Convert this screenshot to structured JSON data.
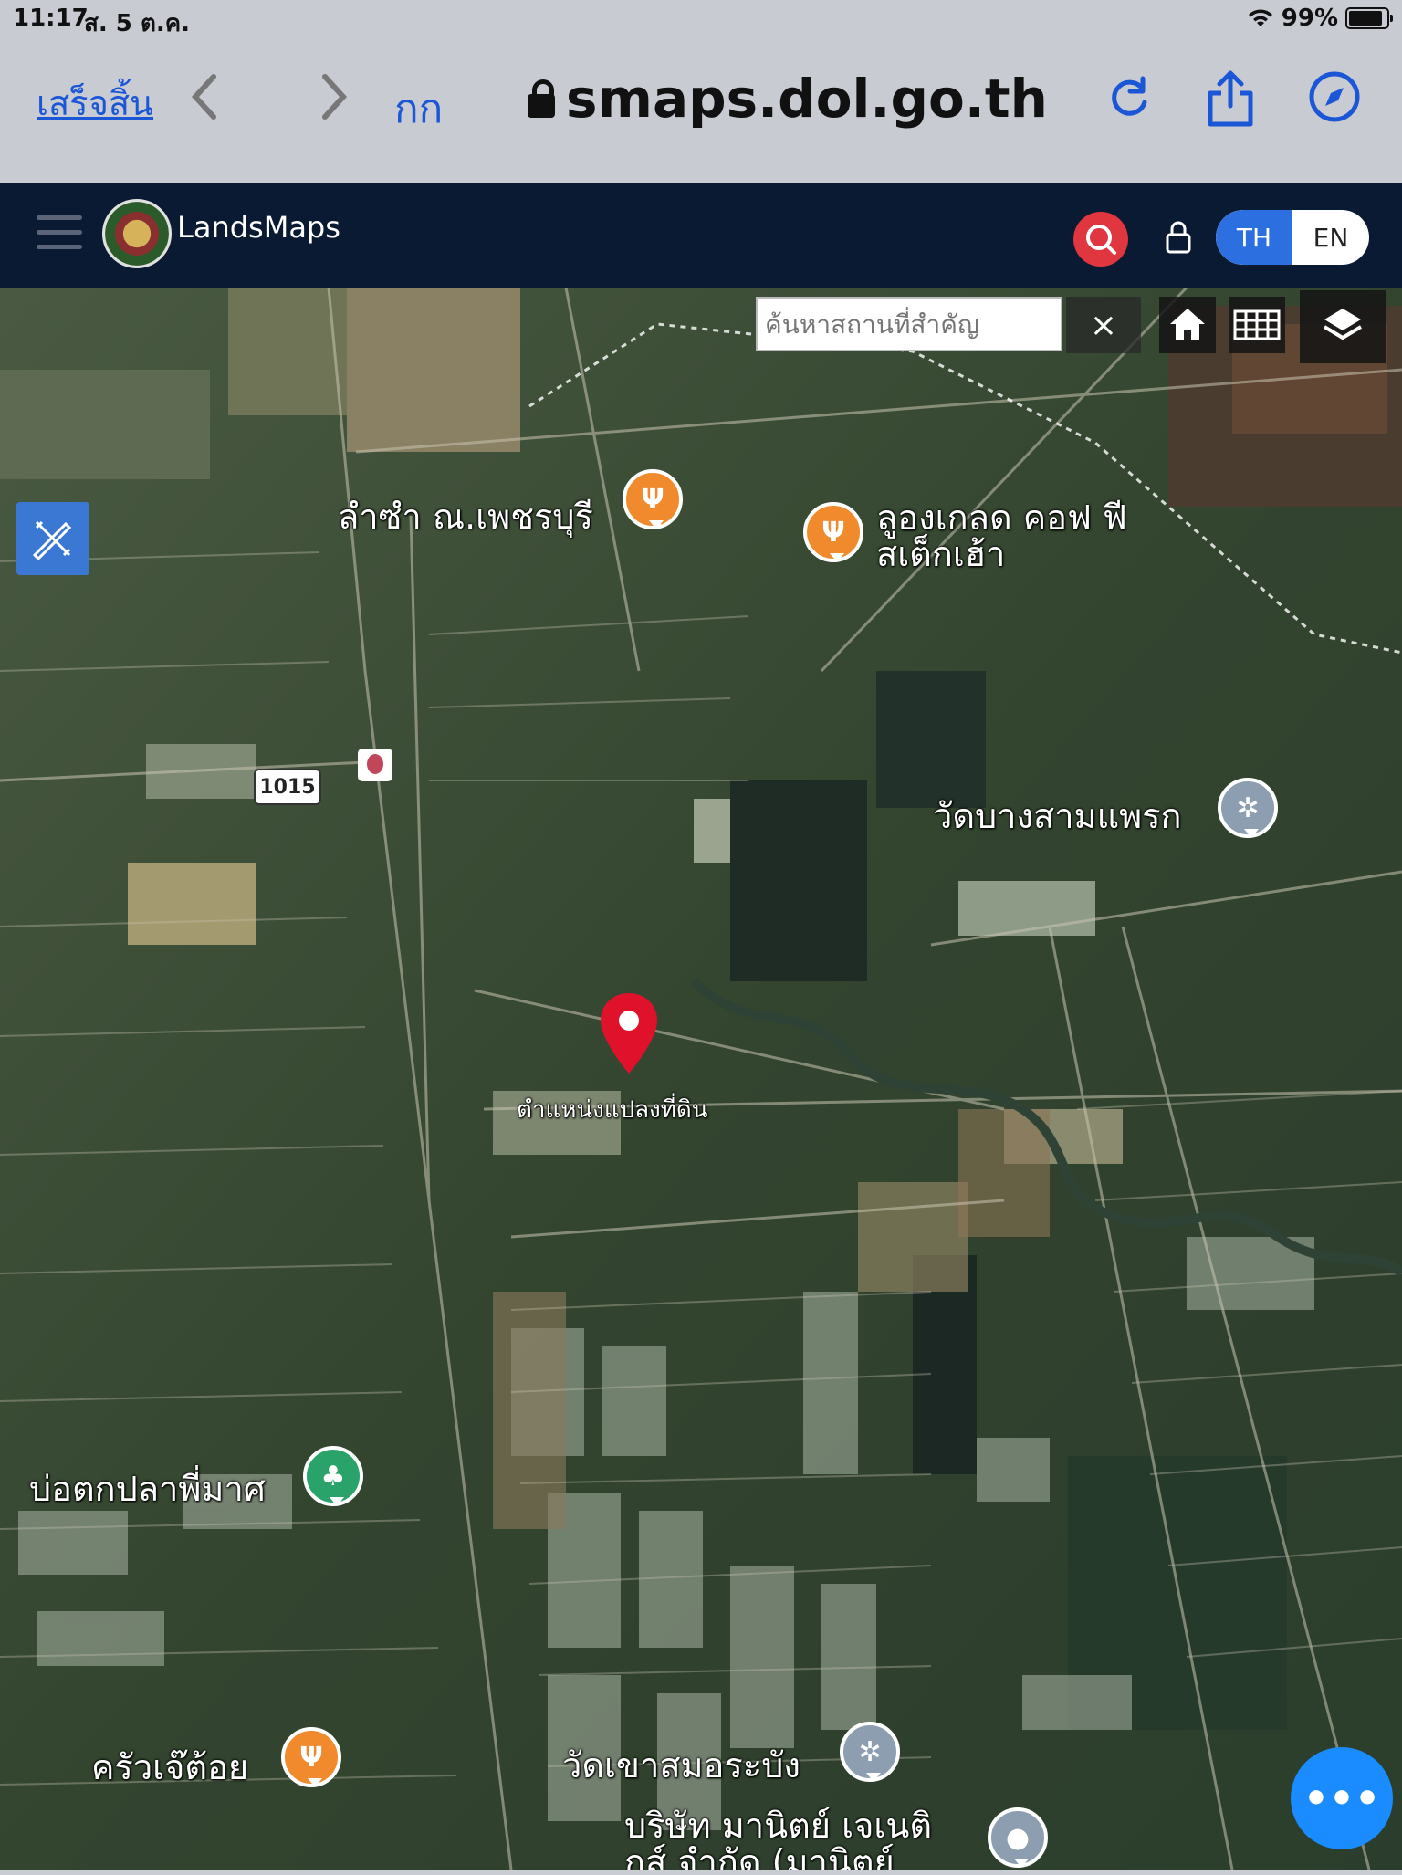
{
  "status_bar": {
    "time": "11:17",
    "date": "ส. 5 ต.ค.",
    "battery": "99%"
  },
  "browser": {
    "done_label": "เสร็จสิ้น",
    "text_size_label": "กก",
    "url": "smaps.dol.go.th"
  },
  "app": {
    "brand": "LandsMaps",
    "lang_th": "TH",
    "lang_en": "EN"
  },
  "map": {
    "search_placeholder": "ค้นหาสถานที่สำคัญ",
    "clear_label": "×",
    "road_number": "1015",
    "pin_label": "ตำแหน่งแปลงที่ดิน",
    "places": [
      {
        "name": "ลำซำ ณ.เพชรบุรี",
        "type": "food"
      },
      {
        "name": "ลูองเกลด คอฟ ฟีสเต็กเฮ้า",
        "type": "food"
      },
      {
        "name": "วัดบางสามแพรก",
        "type": "temple"
      },
      {
        "name": "บ่อตกปลาพี่มาศ",
        "type": "park"
      },
      {
        "name": "ครัวเจ๊ต้อย",
        "type": "food"
      },
      {
        "name": "วัดเขาสมอระบัง",
        "type": "temple"
      },
      {
        "name": "บริษัท มานิตย์ เจเนติ กส์ จำกัด (มานิตย์",
        "type": "poi"
      }
    ]
  },
  "colors": {
    "header_bg": "#0b1a33",
    "search_red": "#e03640",
    "accent_blue": "#2c6fe0",
    "food_orange": "#f08a2c",
    "pin_red": "#e0112b"
  }
}
